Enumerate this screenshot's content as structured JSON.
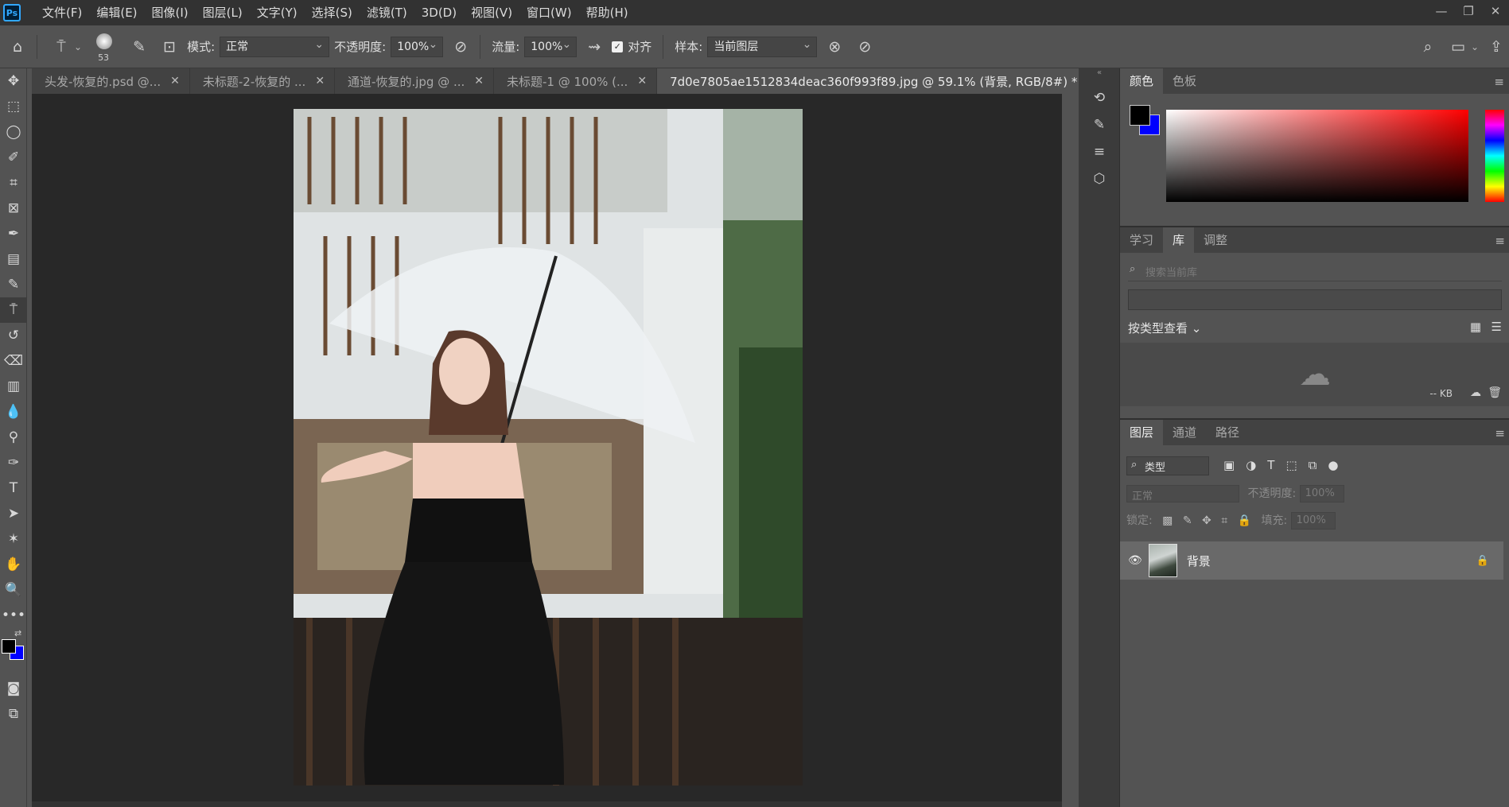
{
  "app": {
    "logo": "Ps"
  },
  "menu": [
    "文件(F)",
    "编辑(E)",
    "图像(I)",
    "图层(L)",
    "文字(Y)",
    "选择(S)",
    "滤镜(T)",
    "3D(D)",
    "视图(V)",
    "窗口(W)",
    "帮助(H)"
  ],
  "options": {
    "brush_size": "53",
    "mode_label": "模式:",
    "mode_value": "正常",
    "opacity_label": "不透明度:",
    "opacity_value": "100%",
    "flow_label": "流量:",
    "flow_value": "100%",
    "align_label": "对齐",
    "sample_label": "样本:",
    "sample_value": "当前图层"
  },
  "tabs": [
    {
      "label": "头发-恢复的.psd @..."
    },
    {
      "label": "未标题-2-恢复的 ..."
    },
    {
      "label": "通道-恢复的.jpg @ ..."
    },
    {
      "label": "未标题-1 @ 100% (..."
    },
    {
      "label": "7d0e7805ae1512834deac360f993f89.jpg  @ 59.1% (背景, RGB/8#) *"
    }
  ],
  "color_panel": {
    "tabs": [
      "颜色",
      "色板"
    ],
    "fg_color": "#000000",
    "bg_color": "#0000ff"
  },
  "library_panel": {
    "tabs": [
      "学习",
      "库",
      "调整"
    ],
    "search_placeholder": "搜索当前库",
    "view_by": "按类型查看",
    "size": "-- KB"
  },
  "layers_panel": {
    "tabs": [
      "图层",
      "通道",
      "路径"
    ],
    "filter": "类型",
    "blend_mode": "正常",
    "opacity_label": "不透明度:",
    "opacity_value": "100%",
    "lock_label": "锁定:",
    "fill_label": "填充:",
    "fill_value": "100%",
    "layer_name": "背景"
  }
}
